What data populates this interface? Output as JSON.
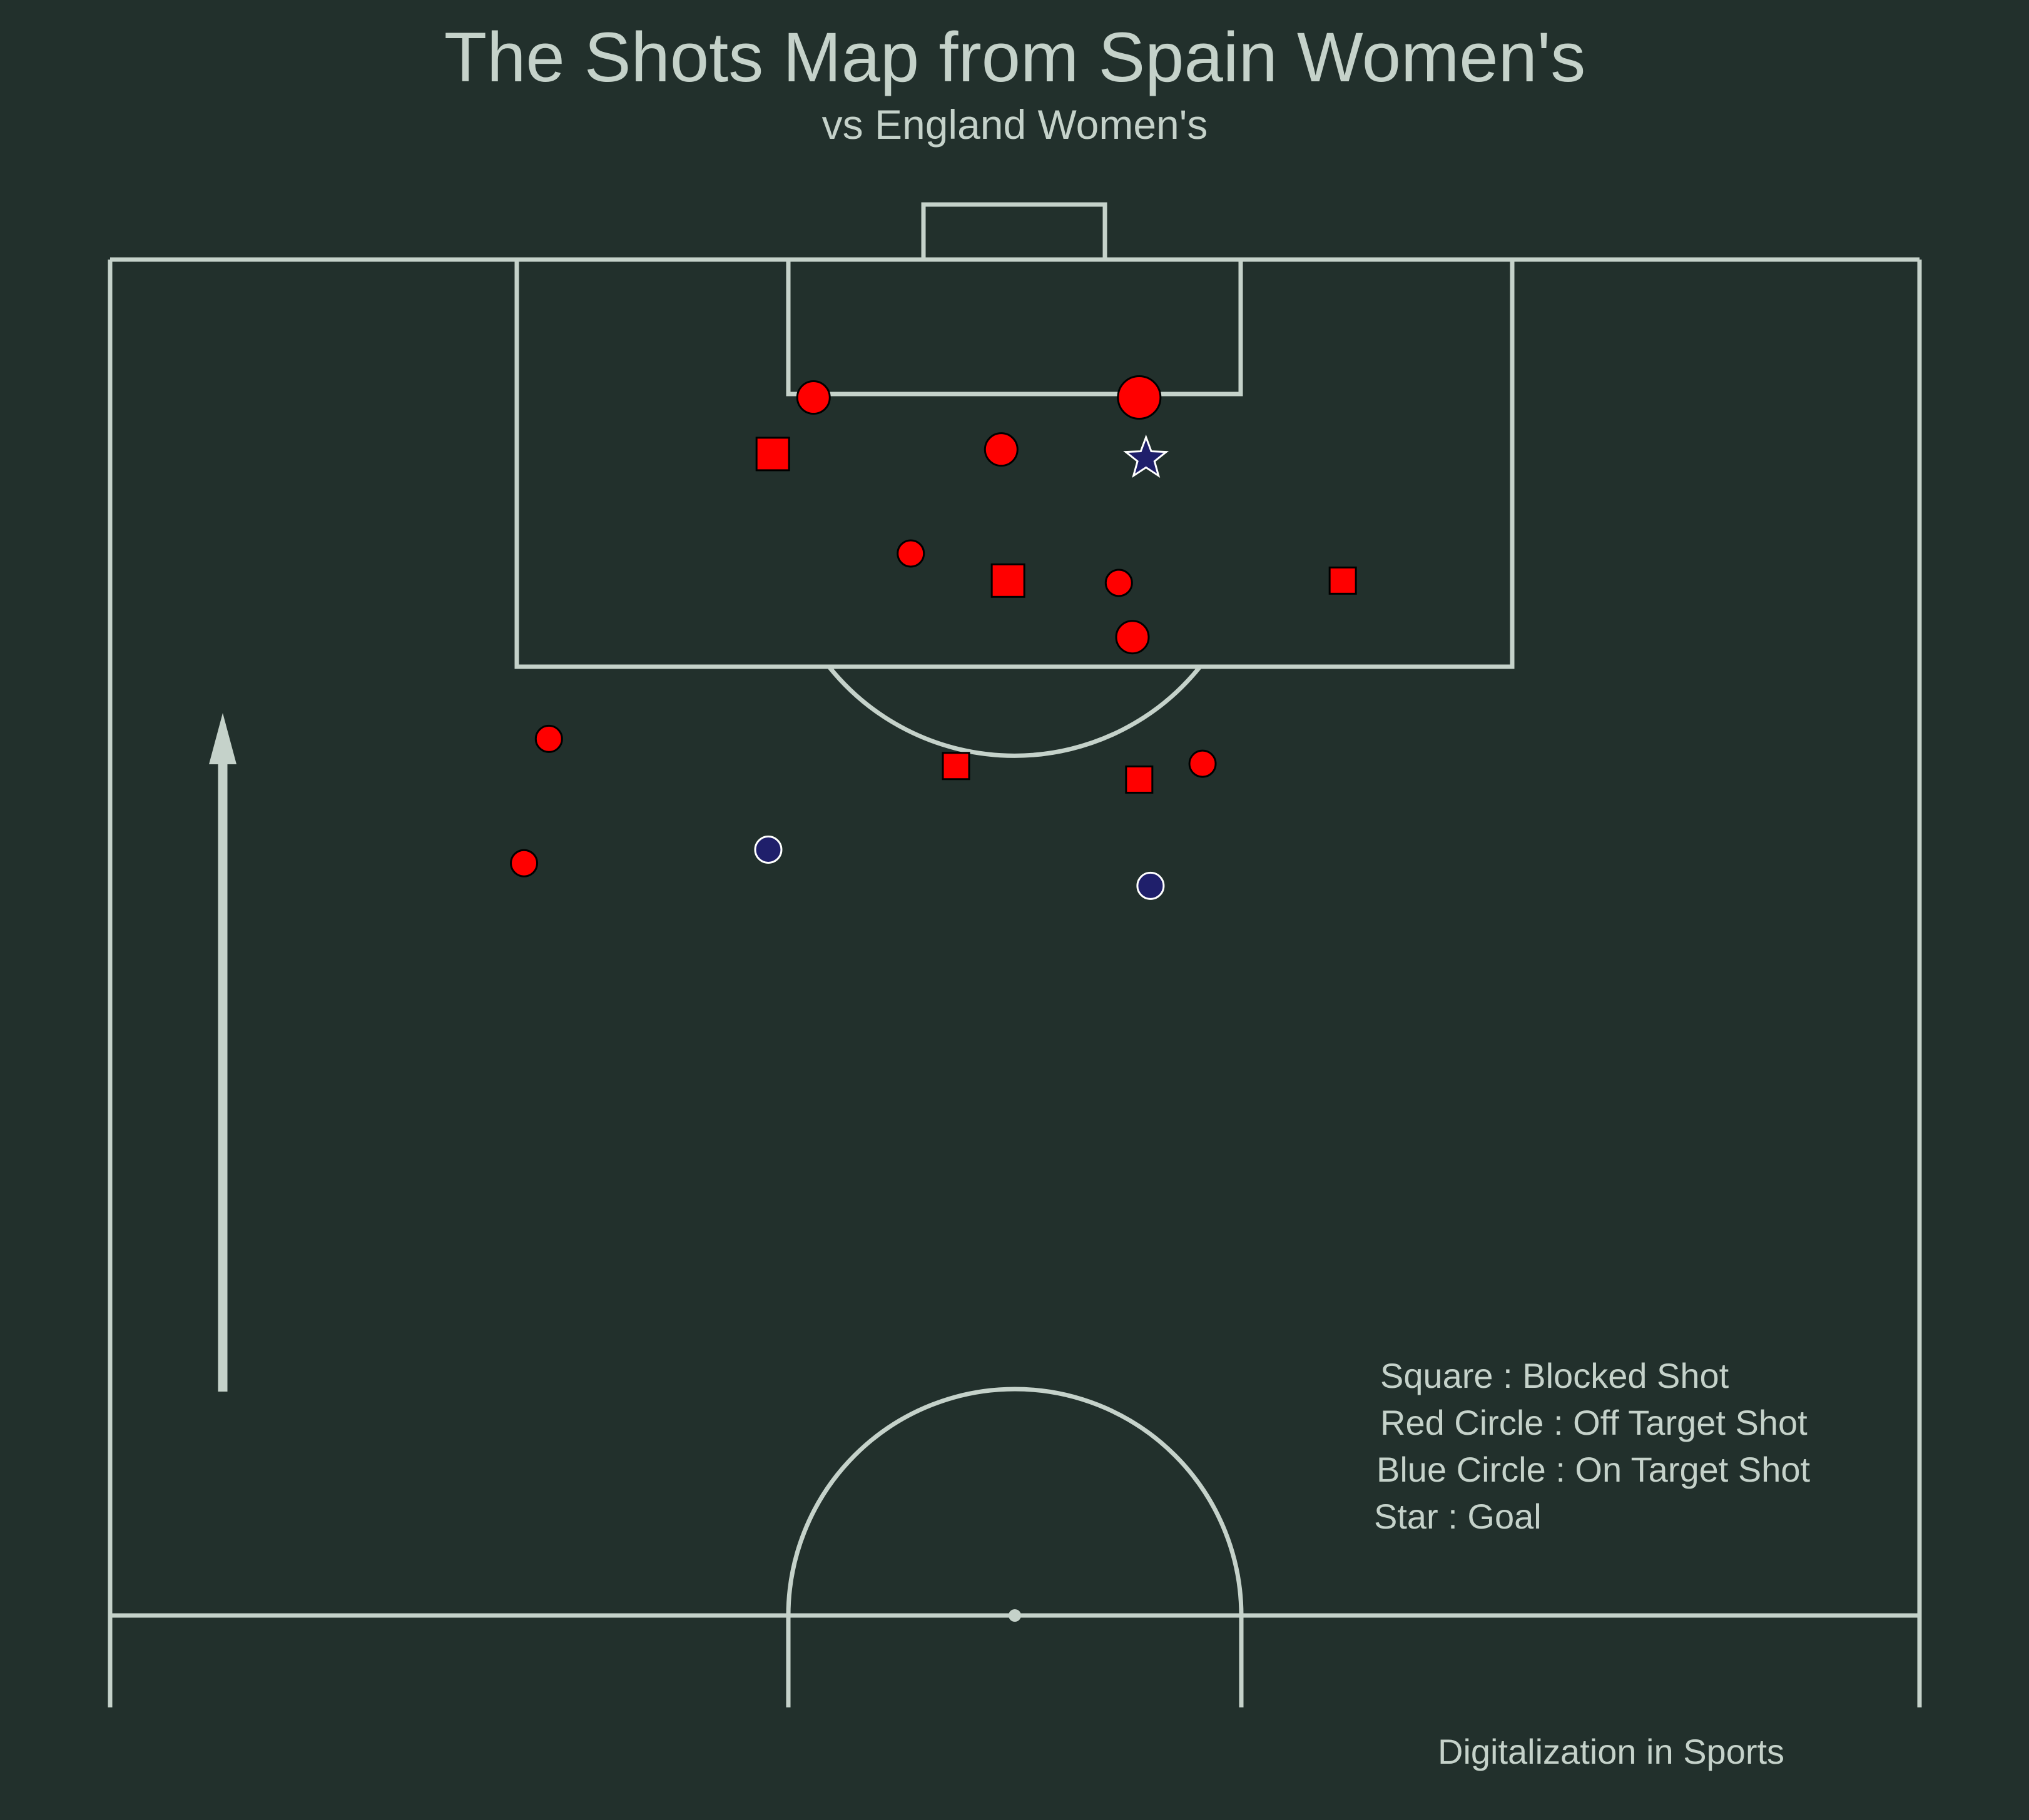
{
  "colors": {
    "background": "#22302c",
    "pitch_line": "#c5d2ca",
    "text": "#c5d2ca",
    "off_target_fill": "#ff0000",
    "on_target_fill": "#1f1f6b",
    "goal_fill": "#1f1f6b",
    "marker_edge_dark": "#000000",
    "marker_edge_light": "#ffffff"
  },
  "title": "The Shots Map from Spain Women's",
  "subtitle": "vs England Women's",
  "legend": {
    "square": "Square : Blocked Shot",
    "red_circle": "Red Circle : Off Target Shot",
    "blue_circle": "Blue Circle : On Target Shot",
    "star": "Star : Goal"
  },
  "credit": "Digitalization in Sports",
  "chart_data": {
    "type": "scatter",
    "pitch": "vertical half pitch, attacking toward the top goal",
    "legend_placement": "bottom-right",
    "grid": false,
    "direction_arrow": "up",
    "shots": [
      {
        "x": 113.9,
        "y": 45.5,
        "outcome": "off_target",
        "size": 3
      },
      {
        "x": 113.9,
        "y": 31.1,
        "outcome": "off_target",
        "size": 2
      },
      {
        "x": 111.4,
        "y": 29.3,
        "outcome": "blocked",
        "size": 2
      },
      {
        "x": 111.6,
        "y": 39.4,
        "outcome": "off_target",
        "size": 2
      },
      {
        "x": 111.2,
        "y": 45.8,
        "outcome": "goal",
        "size": 2
      },
      {
        "x": 107.0,
        "y": 35.4,
        "outcome": "off_target",
        "size": 1
      },
      {
        "x": 105.8,
        "y": 39.7,
        "outcome": "blocked",
        "size": 2
      },
      {
        "x": 105.7,
        "y": 44.6,
        "outcome": "off_target",
        "size": 1
      },
      {
        "x": 105.8,
        "y": 54.5,
        "outcome": "blocked",
        "size": 1
      },
      {
        "x": 103.3,
        "y": 45.2,
        "outcome": "off_target",
        "size": 2
      },
      {
        "x": 98.8,
        "y": 19.4,
        "outcome": "off_target",
        "size": 1
      },
      {
        "x": 97.6,
        "y": 37.4,
        "outcome": "blocked",
        "size": 1
      },
      {
        "x": 97.0,
        "y": 45.5,
        "outcome": "blocked",
        "size": 1
      },
      {
        "x": 97.7,
        "y": 48.3,
        "outcome": "off_target",
        "size": 1
      },
      {
        "x": 93.3,
        "y": 18.3,
        "outcome": "off_target",
        "size": 1
      },
      {
        "x": 93.9,
        "y": 29.1,
        "outcome": "on_target",
        "size": 1
      },
      {
        "x": 92.3,
        "y": 46.0,
        "outcome": "on_target",
        "size": 1
      }
    ]
  }
}
